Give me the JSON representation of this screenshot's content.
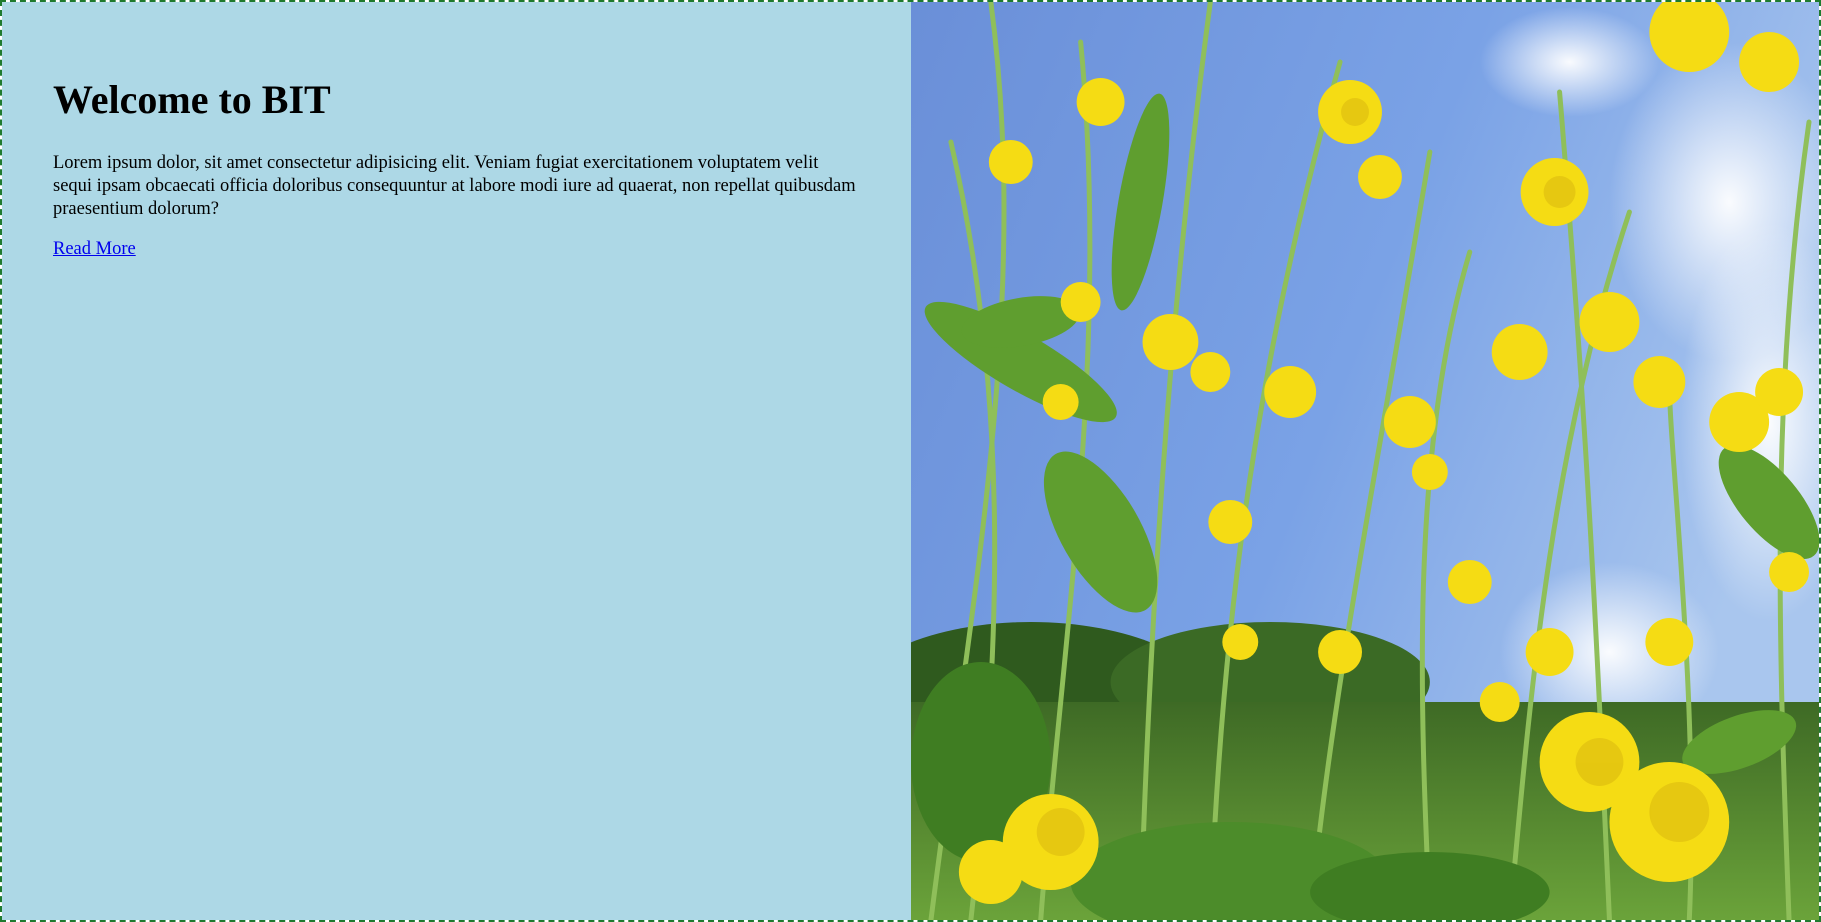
{
  "hero": {
    "title": "Welcome to BIT",
    "body": "Lorem ipsum dolor, sit amet consectetur adipisicing elit. Veniam fugiat exercitationem voluptatem velit sequi ipsam obcaecati officia doloribus consequuntur at labore modi iure ad quaerat, non repellat quibusdam praesentium dolorum?",
    "link_label": "Read More"
  },
  "colors": {
    "left_background": "#add8e6",
    "border": "#1e7a2e",
    "link": "#0000ee",
    "sky": "#6f97e0",
    "flower": "#f5dc14",
    "leaf": "#5f9e2f"
  },
  "image": {
    "subject": "yellow-flower-field-photo"
  }
}
